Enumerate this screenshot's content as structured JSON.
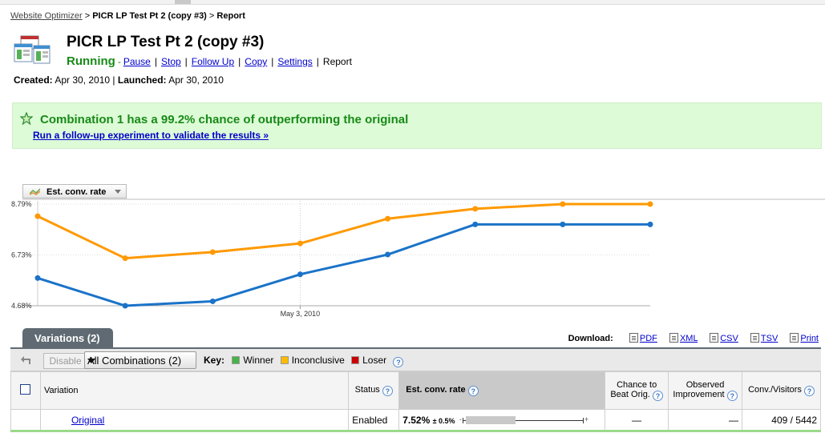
{
  "breadcrumb": {
    "root": "Website Optimizer",
    "separator1": ">",
    "current": "PICR LP Test Pt 2 (copy #3)",
    "separator2": ">",
    "page": "Report"
  },
  "experiment": {
    "title": "PICR LP Test Pt 2 (copy #3)",
    "status": "Running",
    "status_dash": "-",
    "actions": [
      "Pause",
      "Stop",
      "Follow Up",
      "Copy",
      "Settings"
    ],
    "separator": "|",
    "current_view": "Report",
    "created_label": "Created:",
    "created": "Apr 30, 2010",
    "launched_label": "Launched:",
    "launched": "Apr 30, 2010"
  },
  "banner": {
    "message": "Combination 1 has a 99.2% chance of outperforming the original",
    "link": "Run a follow-up experiment to validate the results »",
    "icon": "star-icon"
  },
  "metric_selector": {
    "label": "Est. conv. rate",
    "icon": "line-chart-icon"
  },
  "chart_data": {
    "type": "line",
    "x": [
      "Apr 30, 2010",
      "May 1, 2010",
      "May 2, 2010",
      "May 3, 2010",
      "May 4, 2010",
      "May 5, 2010",
      "May 6, 2010",
      "May 7, 2010"
    ],
    "x_tick_labels": [
      {
        "index": 3,
        "label": "May 3, 2010"
      }
    ],
    "y_tick_labels": [
      "8.79%",
      "6.73%",
      "4.68%"
    ],
    "ylim": [
      4.68,
      8.79
    ],
    "series": [
      {
        "color": "#ff9900",
        "values": [
          8.3,
          6.6,
          6.85,
          7.2,
          8.2,
          8.6,
          8.79,
          8.79
        ]
      },
      {
        "color": "#1a73c8",
        "values": [
          5.8,
          4.68,
          4.86,
          5.95,
          6.75,
          7.97,
          7.97,
          7.97
        ]
      }
    ],
    "grid": "y-dotted, vertical marker at May 3, 2010"
  },
  "variations": {
    "tab_label": "Variations (2)",
    "download_label": "Download:",
    "downloads": [
      "PDF",
      "XML",
      "CSV",
      "TSV",
      "Print"
    ],
    "disable_label": "Disable",
    "combo_value": "All Combinations (2)",
    "key_label": "Key:",
    "key_items": [
      {
        "label": "Winner",
        "color": "#47b347"
      },
      {
        "label": "Inconclusive",
        "color": "#ffbb00"
      },
      {
        "label": "Loser",
        "color": "#cc0000"
      }
    ],
    "help_glyph": "?",
    "columns": {
      "variation": "Variation",
      "status": "Status",
      "est_conv_rate": "Est. conv. rate",
      "chance_line1": "Chance to",
      "chance_line2": "Beat Orig.",
      "observed_line1": "Observed",
      "observed_line2": "Improvement",
      "conv_visitors": "Conv./Visitors"
    },
    "rows": [
      {
        "variation": "Original",
        "status": "Enabled",
        "rate": "7.52%",
        "rate_range": "± 0.5%",
        "range_minus": "-",
        "range_plus": "+",
        "chance": "—",
        "observed": "—",
        "conv_visitors": "409 / 5442"
      }
    ]
  }
}
